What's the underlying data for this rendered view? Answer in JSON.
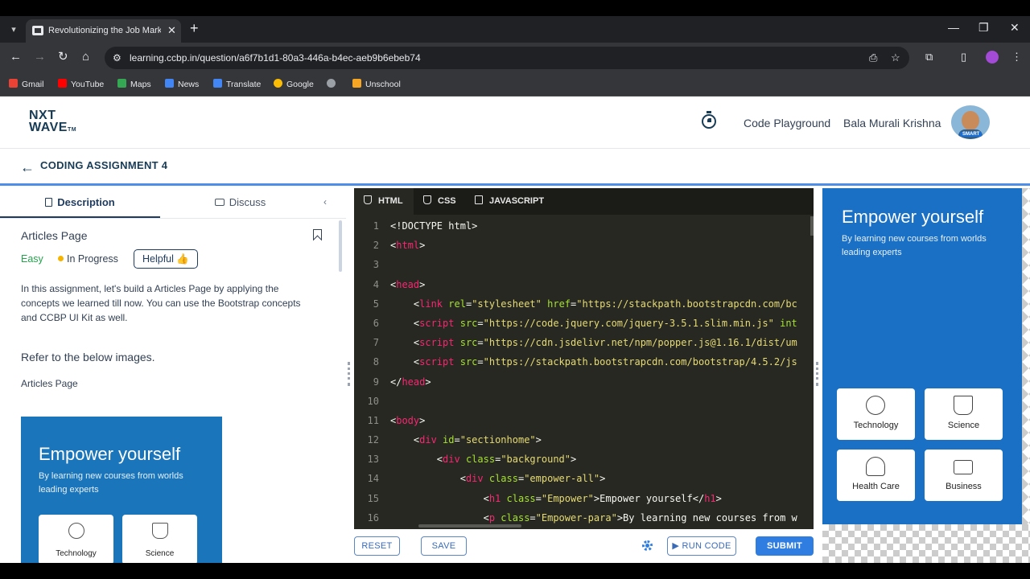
{
  "browser": {
    "tab_title": "Revolutionizing the Job Market",
    "url": "learning.ccbp.in/question/a6f7b1d1-80a3-446a-b4ec-aeb9b6ebeb74",
    "bookmarks": [
      {
        "label": "Gmail",
        "color": "#ea4335"
      },
      {
        "label": "YouTube",
        "color": "#ff0000"
      },
      {
        "label": "Maps",
        "color": "#34a853"
      },
      {
        "label": "News",
        "color": "#4285f4"
      },
      {
        "label": "Translate",
        "color": "#4285f4"
      },
      {
        "label": "Google",
        "color": "#fbbc05"
      },
      {
        "label": "",
        "color": "#9aa0a6"
      },
      {
        "label": "Unschool",
        "color": "#f6a623"
      }
    ]
  },
  "header": {
    "logo_line1": "NXT",
    "logo_line2": "WAVE",
    "logo_tm": "TM",
    "code_playground": "Code Playground",
    "user_name": "Bala Murali Krishna",
    "avatar_tag": "SMART"
  },
  "titlebar": {
    "title": "CODING ASSIGNMENT 4"
  },
  "left_panel": {
    "tabs": [
      "Description",
      "Discuss"
    ],
    "article_title": "Articles Page",
    "difficulty": "Easy",
    "status": "In Progress",
    "helpful": "Helpful",
    "description": "In this assignment, let's build a Articles Page by applying the concepts we learned till now. You can use the Bootstrap concepts and CCBP UI Kit as well.",
    "refer_heading": "Refer to the below images.",
    "caption": "Articles Page",
    "preview": {
      "title": "Empower yourself",
      "para": "By learning new courses from worlds leading experts",
      "cards": [
        "Technology",
        "Science"
      ]
    }
  },
  "editor": {
    "tabs": [
      "HTML",
      "CSS",
      "JAVASCRIPT"
    ],
    "lines": [
      {
        "n": "1",
        "parts": [
          [
            "p",
            "<!DOCTYPE html>"
          ]
        ]
      },
      {
        "n": "2",
        "parts": [
          [
            "p",
            "<"
          ],
          [
            "tg",
            "html"
          ],
          [
            "p",
            ">"
          ]
        ]
      },
      {
        "n": "3",
        "parts": []
      },
      {
        "n": "4",
        "parts": [
          [
            "p",
            "<"
          ],
          [
            "tg",
            "head"
          ],
          [
            "p",
            ">"
          ]
        ]
      },
      {
        "n": "5",
        "parts": [
          [
            "p",
            "    <"
          ],
          [
            "tg",
            "link"
          ],
          [
            "p",
            " "
          ],
          [
            "at",
            "rel"
          ],
          [
            "p",
            "="
          ],
          [
            "st",
            "\"stylesheet\""
          ],
          [
            "p",
            " "
          ],
          [
            "at",
            "href"
          ],
          [
            "p",
            "="
          ],
          [
            "st",
            "\"https://stackpath.bootstrapcdn.com/bc"
          ]
        ]
      },
      {
        "n": "6",
        "parts": [
          [
            "p",
            "    <"
          ],
          [
            "tg",
            "script"
          ],
          [
            "p",
            " "
          ],
          [
            "at",
            "src"
          ],
          [
            "p",
            "="
          ],
          [
            "st",
            "\"https://code.jquery.com/jquery-3.5.1.slim.min.js\""
          ],
          [
            "p",
            " "
          ],
          [
            "at",
            "int"
          ]
        ]
      },
      {
        "n": "7",
        "parts": [
          [
            "p",
            "    <"
          ],
          [
            "tg",
            "script"
          ],
          [
            "p",
            " "
          ],
          [
            "at",
            "src"
          ],
          [
            "p",
            "="
          ],
          [
            "st",
            "\"https://cdn.jsdelivr.net/npm/popper.js@1.16.1/dist/um"
          ]
        ]
      },
      {
        "n": "8",
        "parts": [
          [
            "p",
            "    <"
          ],
          [
            "tg",
            "script"
          ],
          [
            "p",
            " "
          ],
          [
            "at",
            "src"
          ],
          [
            "p",
            "="
          ],
          [
            "st",
            "\"https://stackpath.bootstrapcdn.com/bootstrap/4.5.2/js"
          ]
        ]
      },
      {
        "n": "9",
        "parts": [
          [
            "p",
            "</"
          ],
          [
            "tg",
            "head"
          ],
          [
            "p",
            ">"
          ]
        ]
      },
      {
        "n": "10",
        "parts": []
      },
      {
        "n": "11",
        "parts": [
          [
            "p",
            "<"
          ],
          [
            "tg",
            "body"
          ],
          [
            "p",
            ">"
          ]
        ]
      },
      {
        "n": "12",
        "parts": [
          [
            "p",
            "    <"
          ],
          [
            "tg",
            "div"
          ],
          [
            "p",
            " "
          ],
          [
            "at",
            "id"
          ],
          [
            "p",
            "="
          ],
          [
            "st",
            "\"sectionhome\""
          ],
          [
            "p",
            ">"
          ]
        ]
      },
      {
        "n": "13",
        "parts": [
          [
            "p",
            "        <"
          ],
          [
            "tg",
            "div"
          ],
          [
            "p",
            " "
          ],
          [
            "at",
            "class"
          ],
          [
            "p",
            "="
          ],
          [
            "st",
            "\"background\""
          ],
          [
            "p",
            ">"
          ]
        ]
      },
      {
        "n": "14",
        "parts": [
          [
            "p",
            "            <"
          ],
          [
            "tg",
            "div"
          ],
          [
            "p",
            " "
          ],
          [
            "at",
            "class"
          ],
          [
            "p",
            "="
          ],
          [
            "st",
            "\"empower-all\""
          ],
          [
            "p",
            ">"
          ]
        ]
      },
      {
        "n": "15",
        "parts": [
          [
            "p",
            "                <"
          ],
          [
            "tg",
            "h1"
          ],
          [
            "p",
            " "
          ],
          [
            "at",
            "class"
          ],
          [
            "p",
            "="
          ],
          [
            "st",
            "\"Empower\""
          ],
          [
            "p",
            ">Empower yourself</"
          ],
          [
            "tg",
            "h1"
          ],
          [
            "p",
            ">"
          ]
        ]
      },
      {
        "n": "16",
        "parts": [
          [
            "p",
            "                <"
          ],
          [
            "tg",
            "p"
          ],
          [
            "p",
            " "
          ],
          [
            "at",
            "class"
          ],
          [
            "p",
            "="
          ],
          [
            "st",
            "\"Empower-para\""
          ],
          [
            "p",
            ">By learning new courses from w"
          ]
        ]
      }
    ]
  },
  "bottom_bar": {
    "reset": "RESET",
    "save": "SAVE",
    "run_code": "RUN CODE",
    "submit": "SUBMIT"
  },
  "output": {
    "title": "Empower yourself",
    "para": "By learning new courses from worlds leading experts",
    "cards": [
      "Technology",
      "Science",
      "Health Care",
      "Business"
    ]
  },
  "colors": {
    "brand_dark": "#183b56",
    "accent_blue": "#2f7de1",
    "output_bg": "#1a70c4",
    "editor_bg": "#272822"
  }
}
